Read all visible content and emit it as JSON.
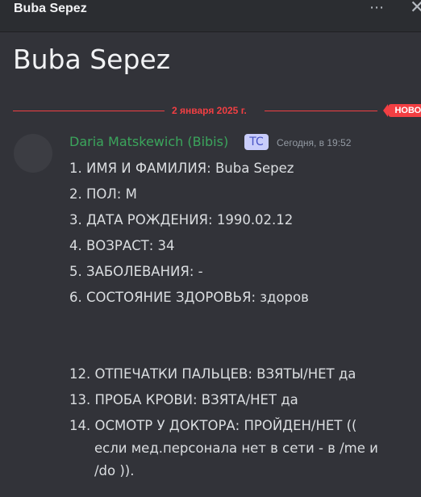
{
  "window": {
    "title": "Buba Sepez",
    "more_icon": "⋯",
    "close_icon": "✕"
  },
  "thread": {
    "title": "Buba Sepez"
  },
  "divider": {
    "date": "2 января 2025 г.",
    "badge": "НОВОЕ",
    "color": "#f23f43"
  },
  "message": {
    "author": "Daria Matskewich (Bibis)",
    "author_color": "#3ba55c",
    "tag": "TC",
    "timestamp": "Сегодня, в 19:52",
    "lines": [
      "1. ИМЯ И ФАМИЛИЯ: Buba Sepez",
      "2. ПОЛ: М",
      "3. ДАТА РОЖДЕНИЯ: 1990.02.12",
      "4. ВОЗРАСТ: 34",
      "5. ЗАБОЛЕВАНИЯ: -",
      "6. СОСТОЯНИЕ ЗДОРОВЬЯ: здоров",
      "12. ОТПЕЧАТКИ ПАЛЬЦЕВ: ВЗЯТЫ/НЕТ да",
      "13. ПРОБА КРОВИ: ВЗЯТА/НЕТ да",
      "14. ОСМОТР У ДОКТОРА: ПРОЙДЕН/НЕТ ((",
      "если мед.персонала нет в сети - в /me и",
      "/do ))."
    ]
  }
}
